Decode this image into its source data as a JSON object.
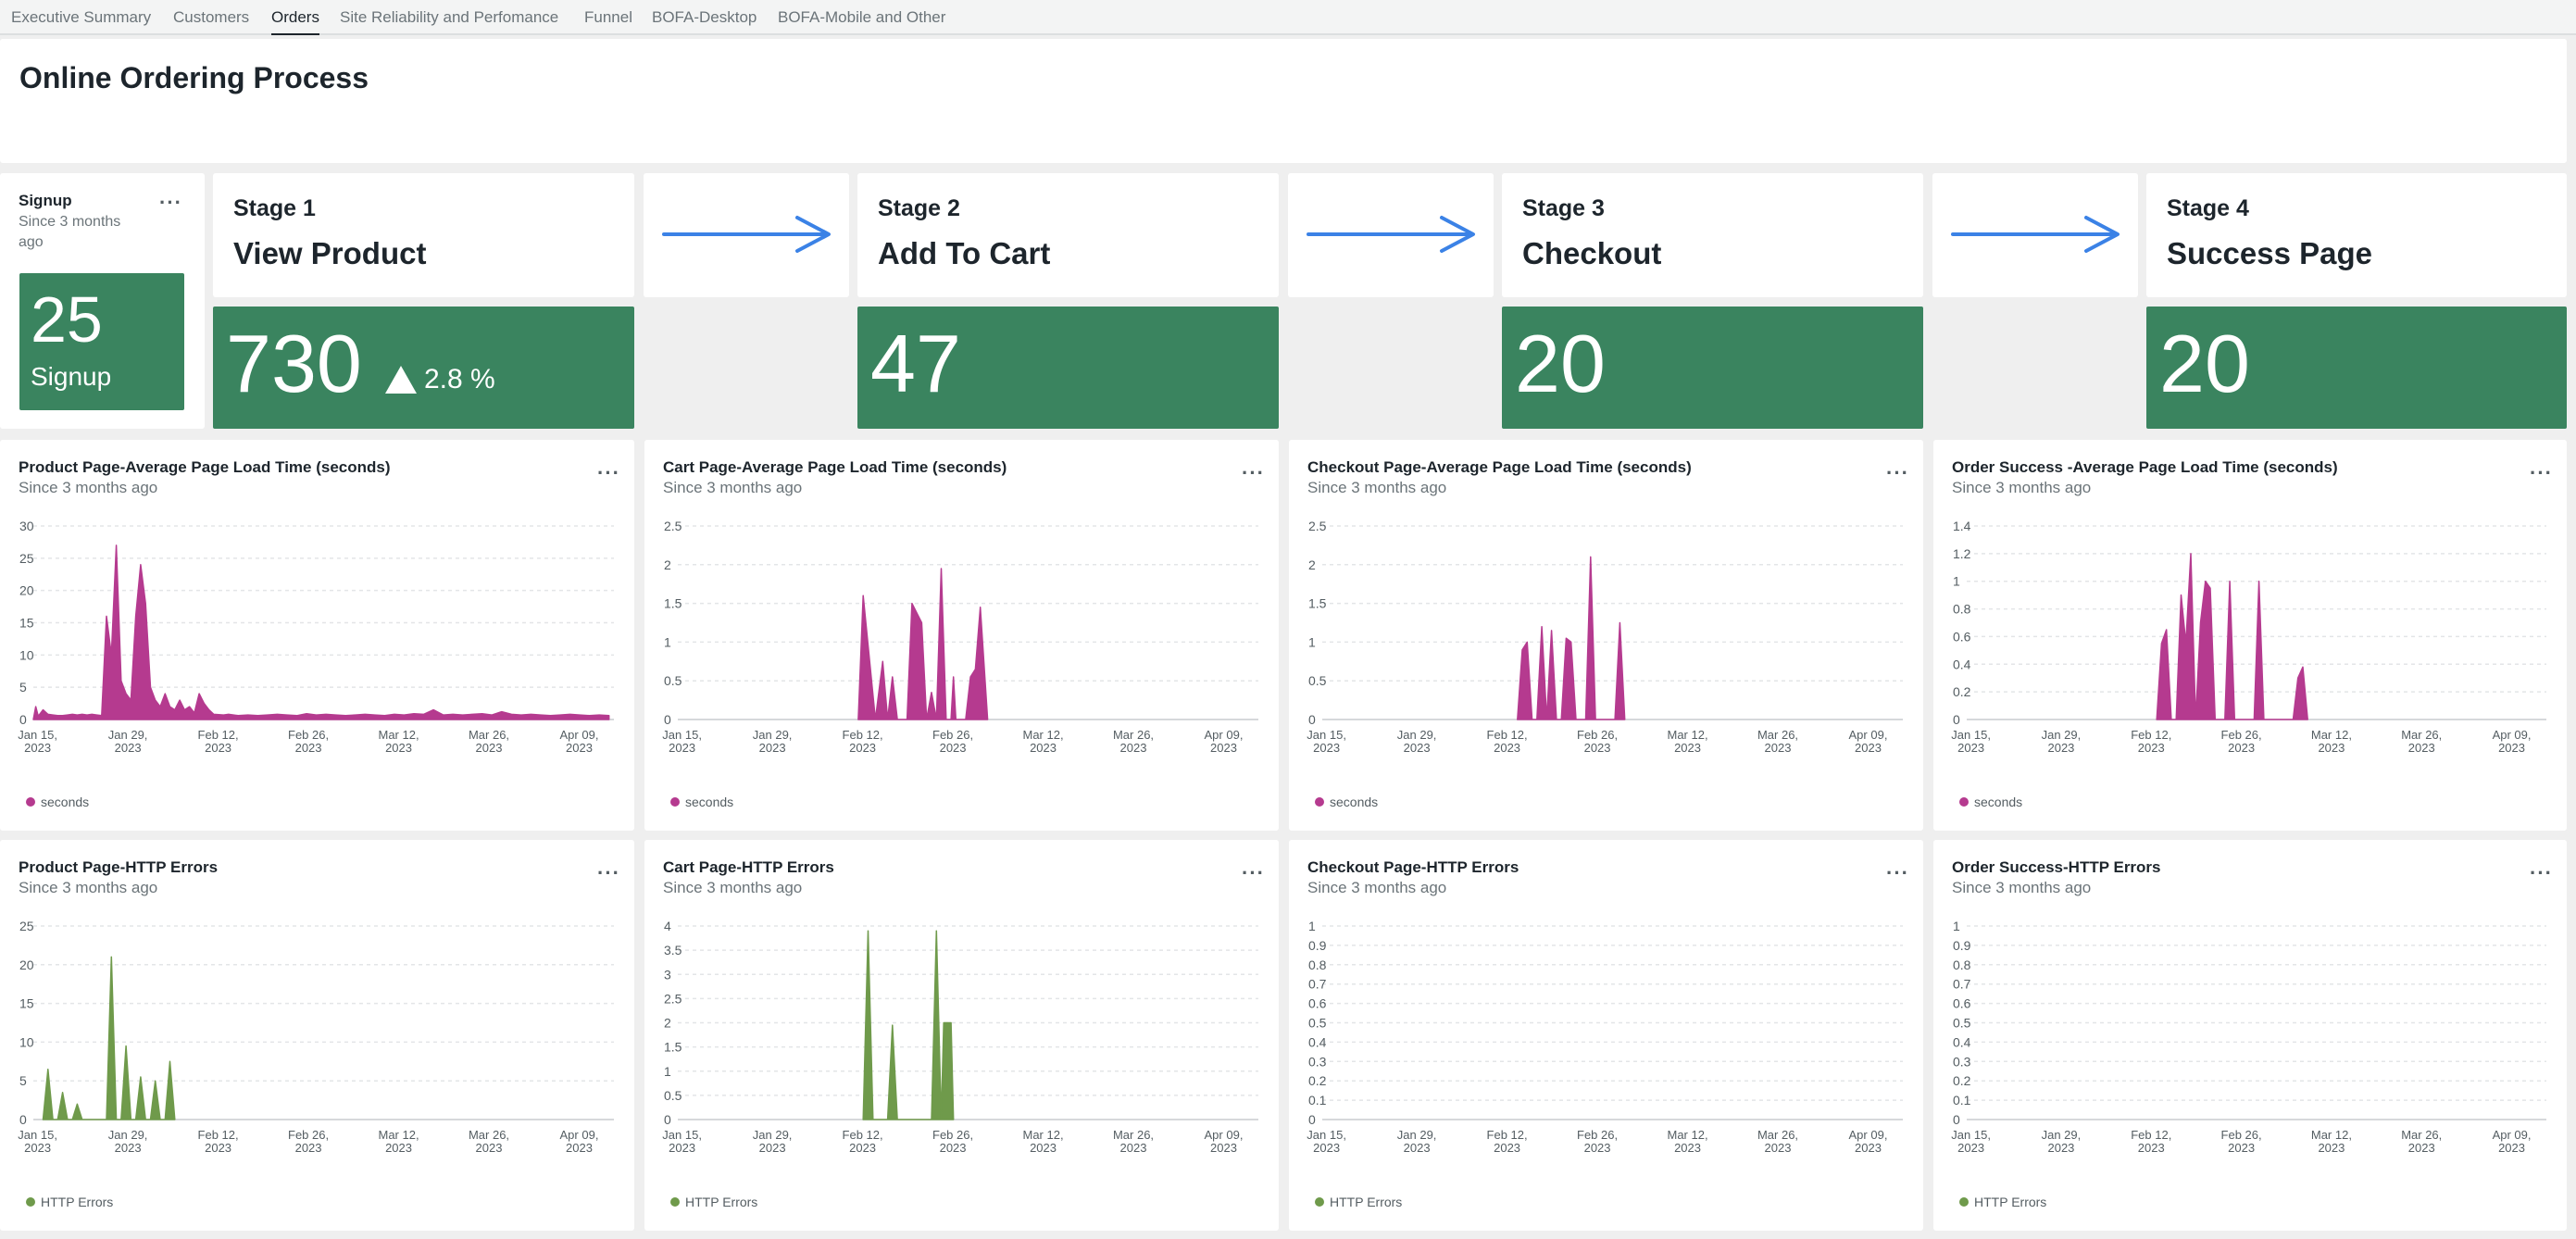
{
  "nav": {
    "tabs": [
      {
        "label": "Executive Summary"
      },
      {
        "label": "Customers"
      },
      {
        "label": "Orders",
        "active": true
      },
      {
        "label": "Site Reliability and Perfomance"
      },
      {
        "label": "Funnel"
      },
      {
        "label": "BOFA-Desktop"
      },
      {
        "label": "BOFA-Mobile and Other"
      }
    ]
  },
  "header": {
    "title": "Online Ordering Process"
  },
  "signup": {
    "title": "Signup",
    "subtitle": "Since 3 months ago",
    "value": "25",
    "label": "Signup"
  },
  "stages": [
    {
      "number": "Stage 1",
      "name": "View Product",
      "value": "730",
      "delta": "2.8 %"
    },
    {
      "number": "Stage 2",
      "name": "Add To Cart",
      "value": "47"
    },
    {
      "number": "Stage 3",
      "name": "Checkout",
      "value": "20"
    },
    {
      "number": "Stage 4",
      "name": "Success Page",
      "value": "20"
    }
  ],
  "colors": {
    "tile_green": "#3a845f",
    "arrow_blue": "#3b82e6",
    "load_series": "#b53a8f",
    "error_series": "#6f9a4b"
  },
  "chart_data": [
    {
      "type": "area",
      "title": "Product Page-Average Page Load Time (seconds)",
      "subtitle": "Since 3 months ago",
      "ylim": [
        0,
        30
      ],
      "yticks": [
        "0",
        "5",
        "10",
        "15",
        "20",
        "25",
        "30"
      ],
      "xticks": [
        [
          "Jan 15,",
          "2023"
        ],
        [
          "Jan 29,",
          "2023"
        ],
        [
          "Feb 12,",
          "2023"
        ],
        [
          "Feb 26,",
          "2023"
        ],
        [
          "Mar 12,",
          "2023"
        ],
        [
          "Mar 26,",
          "2023"
        ],
        [
          "Apr 09,",
          "2023"
        ]
      ],
      "series": [
        {
          "name": "seconds",
          "color": "#b53a8f",
          "points": [
            [
              0,
              0
            ],
            [
              0.5,
              2
            ],
            [
              1,
              0.5
            ],
            [
              2,
              1.5
            ],
            [
              3,
              0.8
            ],
            [
              4,
              0.7
            ],
            [
              5,
              0.6
            ],
            [
              6,
              0.6
            ],
            [
              7,
              0.7
            ],
            [
              8,
              0.8
            ],
            [
              9,
              0.7
            ],
            [
              10,
              0.8
            ],
            [
              11,
              0.7
            ],
            [
              12,
              0.8
            ],
            [
              13,
              0.7
            ],
            [
              14,
              0.6
            ],
            [
              15,
              16
            ],
            [
              16,
              10
            ],
            [
              17,
              27
            ],
            [
              18,
              6
            ],
            [
              19,
              4
            ],
            [
              20,
              3
            ],
            [
              21,
              16
            ],
            [
              22,
              24
            ],
            [
              23,
              18
            ],
            [
              24,
              5
            ],
            [
              25,
              3
            ],
            [
              26,
              2
            ],
            [
              27,
              4
            ],
            [
              28,
              2
            ],
            [
              29,
              1.5
            ],
            [
              30,
              3
            ],
            [
              31,
              1.5
            ],
            [
              32,
              2
            ],
            [
              33,
              1
            ],
            [
              34,
              4
            ],
            [
              35,
              2.5
            ],
            [
              36,
              1.5
            ],
            [
              37,
              0.8
            ],
            [
              39,
              0.7
            ],
            [
              40,
              0.8
            ],
            [
              42,
              0.6
            ],
            [
              44,
              0.7
            ],
            [
              46,
              0.6
            ],
            [
              48,
              0.7
            ],
            [
              50,
              0.8
            ],
            [
              52,
              0.7
            ],
            [
              54,
              0.6
            ],
            [
              56,
              0.9
            ],
            [
              58,
              0.7
            ],
            [
              60,
              0.8
            ],
            [
              62,
              0.7
            ],
            [
              64,
              0.6
            ],
            [
              66,
              0.7
            ],
            [
              68,
              0.8
            ],
            [
              70,
              0.7
            ],
            [
              72,
              0.6
            ],
            [
              74,
              0.8
            ],
            [
              76,
              0.7
            ],
            [
              78,
              0.9
            ],
            [
              80,
              0.8
            ],
            [
              82,
              1.5
            ],
            [
              84,
              0.7
            ],
            [
              86,
              0.8
            ],
            [
              88,
              0.7
            ],
            [
              90,
              0.8
            ],
            [
              92,
              0.9
            ],
            [
              94,
              0.7
            ],
            [
              96,
              1.2
            ],
            [
              98,
              0.8
            ],
            [
              100,
              0.7
            ],
            [
              102,
              0.8
            ],
            [
              104,
              0.7
            ],
            [
              106,
              0.6
            ],
            [
              108,
              0.7
            ],
            [
              110,
              0.8
            ],
            [
              112,
              0.7
            ],
            [
              114,
              0.6
            ],
            [
              116,
              0.7
            ],
            [
              118,
              0.6
            ]
          ]
        }
      ]
    },
    {
      "type": "area",
      "title": "Cart Page-Average Page Load Time (seconds)",
      "subtitle": "Since 3 months ago",
      "ylim": [
        0,
        2.5
      ],
      "yticks": [
        "0",
        "0.5",
        "1",
        "1.5",
        "2",
        "2.5"
      ],
      "xticks": [
        [
          "Jan 15,",
          "2023"
        ],
        [
          "Jan 29,",
          "2023"
        ],
        [
          "Feb 12,",
          "2023"
        ],
        [
          "Feb 26,",
          "2023"
        ],
        [
          "Mar 12,",
          "2023"
        ],
        [
          "Mar 26,",
          "2023"
        ],
        [
          "Apr 09,",
          "2023"
        ]
      ],
      "series": [
        {
          "name": "seconds",
          "color": "#b53a8f",
          "points": [
            [
              37,
              0
            ],
            [
              38,
              1.6
            ],
            [
              40.5,
              0
            ],
            [
              42,
              0.75
            ],
            [
              43,
              0
            ],
            [
              44,
              0.55
            ],
            [
              45,
              0
            ],
            [
              47,
              0
            ],
            [
              48,
              1.5
            ],
            [
              50,
              1.25
            ],
            [
              51,
              0
            ],
            [
              52,
              0.35
            ],
            [
              53,
              0
            ],
            [
              54,
              1.95
            ],
            [
              55,
              0
            ],
            [
              56,
              0
            ],
            [
              56.5,
              0.55
            ],
            [
              57,
              0
            ],
            [
              59,
              0
            ],
            [
              60,
              0.55
            ],
            [
              61,
              0.65
            ],
            [
              62,
              1.45
            ],
            [
              63.5,
              0
            ]
          ]
        }
      ]
    },
    {
      "type": "area",
      "title": "Checkout Page-Average Page Load Time (seconds)",
      "subtitle": "Since 3 months ago",
      "ylim": [
        0,
        2.5
      ],
      "yticks": [
        "0",
        "0.5",
        "1",
        "1.5",
        "2",
        "2.5"
      ],
      "xticks": [
        [
          "Jan 15,",
          "2023"
        ],
        [
          "Jan 29,",
          "2023"
        ],
        [
          "Feb 12,",
          "2023"
        ],
        [
          "Feb 26,",
          "2023"
        ],
        [
          "Mar 12,",
          "2023"
        ],
        [
          "Mar 26,",
          "2023"
        ],
        [
          "Apr 09,",
          "2023"
        ]
      ],
      "series": [
        {
          "name": "seconds",
          "color": "#b53a8f",
          "points": [
            [
              40,
              0
            ],
            [
              41,
              0.9
            ],
            [
              42,
              1.0
            ],
            [
              43,
              0
            ],
            [
              44,
              0
            ],
            [
              45,
              1.2
            ],
            [
              46,
              0
            ],
            [
              47,
              1.15
            ],
            [
              48,
              0
            ],
            [
              49,
              0
            ],
            [
              50,
              1.05
            ],
            [
              51,
              1.0
            ],
            [
              52,
              0
            ],
            [
              54,
              0
            ],
            [
              55,
              2.1
            ],
            [
              56,
              0
            ],
            [
              60,
              0
            ],
            [
              61,
              1.25
            ],
            [
              62,
              0
            ]
          ]
        }
      ]
    },
    {
      "type": "area",
      "title": "Order Success -Average Page Load Time (seconds)",
      "subtitle": "Since 3 months ago",
      "ylim": [
        0,
        1.4
      ],
      "yticks": [
        "0",
        "0.2",
        "0.4",
        "0.6",
        "0.8",
        "1",
        "1.2",
        "1.4"
      ],
      "xticks": [
        [
          "Jan 15,",
          "2023"
        ],
        [
          "Jan 29,",
          "2023"
        ],
        [
          "Feb 12,",
          "2023"
        ],
        [
          "Feb 26,",
          "2023"
        ],
        [
          "Mar 12,",
          "2023"
        ],
        [
          "Mar 26,",
          "2023"
        ],
        [
          "Apr 09,",
          "2023"
        ]
      ],
      "series": [
        {
          "name": "seconds",
          "color": "#b53a8f",
          "points": [
            [
              39,
              0
            ],
            [
              40,
              0.55
            ],
            [
              41,
              0.65
            ],
            [
              42,
              0
            ],
            [
              43,
              0
            ],
            [
              44,
              0.9
            ],
            [
              45,
              0.55
            ],
            [
              46,
              1.2
            ],
            [
              47,
              0
            ],
            [
              48,
              0.7
            ],
            [
              49,
              1.0
            ],
            [
              50,
              0.95
            ],
            [
              51,
              0
            ],
            [
              53,
              0
            ],
            [
              54,
              1.0
            ],
            [
              55,
              0
            ],
            [
              59,
              0
            ],
            [
              60,
              1.0
            ],
            [
              61,
              0
            ],
            [
              67,
              0
            ],
            [
              68,
              0.3
            ],
            [
              69,
              0.38
            ],
            [
              70,
              0
            ]
          ]
        }
      ]
    },
    {
      "type": "area",
      "title": "Product Page-HTTP Errors",
      "subtitle": "Since 3 months ago",
      "ylim": [
        0,
        25
      ],
      "yticks": [
        "0",
        "5",
        "10",
        "15",
        "20",
        "25"
      ],
      "xticks": [
        [
          "Jan 15,",
          "2023"
        ],
        [
          "Jan 29,",
          "2023"
        ],
        [
          "Feb 12,",
          "2023"
        ],
        [
          "Feb 26,",
          "2023"
        ],
        [
          "Mar 12,",
          "2023"
        ],
        [
          "Mar 26,",
          "2023"
        ],
        [
          "Apr 09,",
          "2023"
        ]
      ],
      "series": [
        {
          "name": "HTTP Errors",
          "color": "#6f9a4b",
          "points": [
            [
              2,
              0
            ],
            [
              3,
              6.5
            ],
            [
              4,
              0
            ],
            [
              5,
              0
            ],
            [
              6,
              3.5
            ],
            [
              7,
              0
            ],
            [
              8,
              0
            ],
            [
              9,
              2
            ],
            [
              10,
              0
            ],
            [
              15,
              0
            ],
            [
              16,
              21
            ],
            [
              17,
              0
            ],
            [
              18,
              0
            ],
            [
              19,
              9.5
            ],
            [
              20,
              0
            ],
            [
              21,
              0
            ],
            [
              22,
              5.5
            ],
            [
              23,
              0
            ],
            [
              24,
              0
            ],
            [
              25,
              5
            ],
            [
              26,
              0
            ],
            [
              27,
              0
            ],
            [
              28,
              7.5
            ],
            [
              29,
              0
            ]
          ]
        }
      ]
    },
    {
      "type": "area",
      "title": "Cart Page-HTTP Errors",
      "subtitle": "Since 3 months ago",
      "ylim": [
        0,
        4
      ],
      "yticks": [
        "0",
        "0.5",
        "1",
        "1.5",
        "2",
        "2.5",
        "3",
        "3.5",
        "4"
      ],
      "xticks": [
        [
          "Jan 15,",
          "2023"
        ],
        [
          "Jan 29,",
          "2023"
        ],
        [
          "Feb 12,",
          "2023"
        ],
        [
          "Feb 26,",
          "2023"
        ],
        [
          "Mar 12,",
          "2023"
        ],
        [
          "Mar 26,",
          "2023"
        ],
        [
          "Apr 09,",
          "2023"
        ]
      ],
      "series": [
        {
          "name": "HTTP Errors",
          "color": "#6f9a4b",
          "points": [
            [
              38,
              0
            ],
            [
              39,
              3.9
            ],
            [
              40,
              0
            ],
            [
              43,
              0
            ],
            [
              44,
              1.95
            ],
            [
              45,
              0
            ],
            [
              52,
              0
            ],
            [
              53,
              3.9
            ],
            [
              54,
              0
            ],
            [
              54.5,
              2.0
            ],
            [
              56,
              2.0
            ],
            [
              56.5,
              0
            ]
          ]
        }
      ]
    },
    {
      "type": "area",
      "title": "Checkout Page-HTTP Errors",
      "subtitle": "Since 3 months ago",
      "ylim": [
        0,
        1
      ],
      "yticks": [
        "0",
        "0.1",
        "0.2",
        "0.3",
        "0.4",
        "0.5",
        "0.6",
        "0.7",
        "0.8",
        "0.9",
        "1"
      ],
      "xticks": [
        [
          "Jan 15,",
          "2023"
        ],
        [
          "Jan 29,",
          "2023"
        ],
        [
          "Feb 12,",
          "2023"
        ],
        [
          "Feb 26,",
          "2023"
        ],
        [
          "Mar 12,",
          "2023"
        ],
        [
          "Mar 26,",
          "2023"
        ],
        [
          "Apr 09,",
          "2023"
        ]
      ],
      "series": [
        {
          "name": "HTTP Errors",
          "color": "#6f9a4b",
          "points": []
        }
      ]
    },
    {
      "type": "area",
      "title": "Order Success-HTTP Errors",
      "subtitle": "Since 3 months ago",
      "ylim": [
        0,
        1
      ],
      "yticks": [
        "0",
        "0.1",
        "0.2",
        "0.3",
        "0.4",
        "0.5",
        "0.6",
        "0.7",
        "0.8",
        "0.9",
        "1"
      ],
      "xticks": [
        [
          "Jan 15,",
          "2023"
        ],
        [
          "Jan 29,",
          "2023"
        ],
        [
          "Feb 12,",
          "2023"
        ],
        [
          "Feb 26,",
          "2023"
        ],
        [
          "Mar 12,",
          "2023"
        ],
        [
          "Mar 26,",
          "2023"
        ],
        [
          "Apr 09,",
          "2023"
        ]
      ],
      "series": [
        {
          "name": "HTTP Errors",
          "color": "#6f9a4b",
          "points": []
        }
      ]
    }
  ]
}
